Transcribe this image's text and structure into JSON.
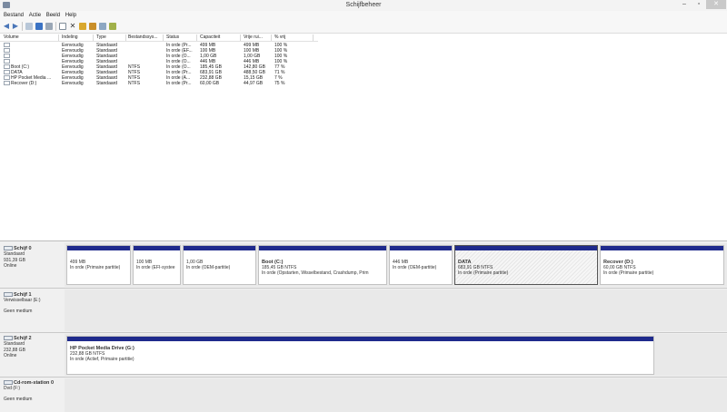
{
  "window": {
    "title": "Schijfbeheer",
    "min": "–",
    "max": "▫",
    "close": "✕"
  },
  "menu": [
    "Bestand",
    "Actie",
    "Beeld",
    "Help"
  ],
  "list": {
    "headers": [
      "Volume",
      "Indeling",
      "Type",
      "Bestandssys...",
      "Status",
      "Capaciteit",
      "Vrije rui...",
      "% vrij"
    ],
    "rows": [
      [
        "",
        "Eenvoudig",
        "Standaard",
        "",
        "In orde (Pr...",
        "499 MB",
        "499 MB",
        "100 %"
      ],
      [
        "",
        "Eenvoudig",
        "Standaard",
        "",
        "In orde (EF...",
        "100 MB",
        "100 MB",
        "100 %"
      ],
      [
        "",
        "Eenvoudig",
        "Standaard",
        "",
        "In orde (O...",
        "1,00 GB",
        "1,00 GB",
        "100 %"
      ],
      [
        "",
        "Eenvoudig",
        "Standaard",
        "",
        "In orde (O...",
        "446 MB",
        "446 MB",
        "100 %"
      ],
      [
        "Boot (C:)",
        "Eenvoudig",
        "Standaard",
        "NTFS",
        "In orde (O...",
        "185,45 GB",
        "142,80 GB",
        "77 %"
      ],
      [
        "DATA",
        "Eenvoudig",
        "Standaard",
        "NTFS",
        "In orde (Pr...",
        "683,91 GB",
        "488,50 GB",
        "71 %"
      ],
      [
        "HP Pocket Media ...",
        "Eenvoudig",
        "Standaard",
        "NTFS",
        "In orde (A...",
        "232,88 GB",
        "15,15 GB",
        "7 %"
      ],
      [
        "Recover (D:)",
        "Eenvoudig",
        "Standaard",
        "NTFS",
        "In orde (Pr...",
        "60,00 GB",
        "44,97 GB",
        "75 %"
      ]
    ]
  },
  "disks": [
    {
      "name": "Schijf 0",
      "type": "Standaard",
      "size": "931,39 GB",
      "state": "Online"
    },
    {
      "name": "Schijf 1",
      "type": "Verwisselbaar (E:)",
      "size": "",
      "state": "Geen medium"
    },
    {
      "name": "Schijf 2",
      "type": "Standaard",
      "size": "232,88 GB",
      "state": "Online"
    },
    {
      "name": "Cd-rom-station 0",
      "type": "Dvd (F:)",
      "size": "",
      "state": "Geen medium"
    }
  ],
  "disk0_parts": [
    {
      "name": "",
      "size": "499 MB",
      "status": "In orde (Primaire partitie)"
    },
    {
      "name": "",
      "size": "100 MB",
      "status": "In orde (EFI-systee"
    },
    {
      "name": "",
      "size": "1,00 GB",
      "status": "In orde (OEM-partitie)"
    },
    {
      "name": "Boot (C:)",
      "size": "185,45 GB NTFS",
      "status": "In orde (Opstarten, Wisselbestand, Crashdump, Prim"
    },
    {
      "name": "",
      "size": "446 MB",
      "status": "In orde (OEM-partitie)"
    },
    {
      "name": "DATA",
      "size": "683,91 GB NTFS",
      "status": "In orde (Primaire partitie)"
    },
    {
      "name": "Recover (D:)",
      "size": "60,00 GB NTFS",
      "status": "In orde (Primaire partitie)"
    }
  ],
  "disk2_part": {
    "name": "HP Pocket Media Drive (G:)",
    "size": "232,88 GB NTFS",
    "status": "In orde (Actief, Primaire partitie)"
  }
}
